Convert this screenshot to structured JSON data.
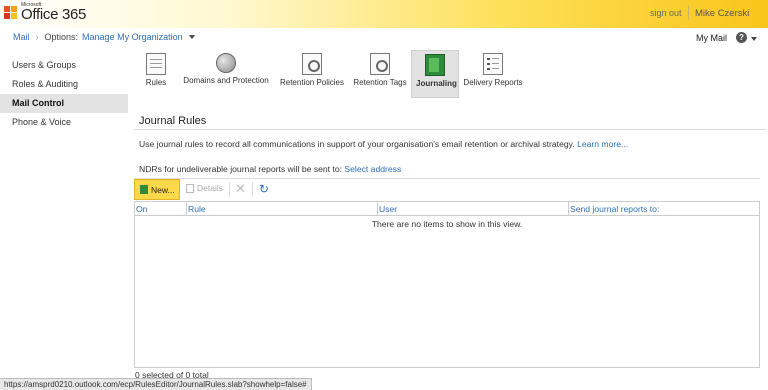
{
  "header": {
    "brand_small": "Microsoft",
    "brand_product": "Office 365",
    "signout_label": "sign out",
    "user_name": "Mike Czerski",
    "my_mail_label": "My Mail",
    "help_glyph": "?"
  },
  "breadcrumb": {
    "mail_label": "Mail",
    "options_label": "Options:",
    "scope_label": "Manage My Organization"
  },
  "leftnav": {
    "items": [
      {
        "label": "Users & Groups",
        "active": false
      },
      {
        "label": "Roles & Auditing",
        "active": false
      },
      {
        "label": "Mail Control",
        "active": true
      },
      {
        "label": "Phone & Voice",
        "active": false
      }
    ]
  },
  "tabs": [
    {
      "label": "Rules",
      "icon": "rules-icon",
      "active": false
    },
    {
      "label": "Domains and Protection",
      "icon": "globe-icon",
      "active": false
    },
    {
      "label": "Retention Policies",
      "icon": "retention-policies-icon",
      "active": false
    },
    {
      "label": "Retention Tags",
      "icon": "retention-tags-icon",
      "active": false
    },
    {
      "label": "Journaling",
      "icon": "journal-book-icon",
      "active": true
    },
    {
      "label": "Delivery Reports",
      "icon": "delivery-reports-icon",
      "active": false
    }
  ],
  "main": {
    "title": "Journal Rules",
    "description": "Use journal rules to record all communications in support of your organisation's email retention or archival strategy.",
    "learn_more": "Learn more...",
    "ndr_text": "NDRs for undeliverable journal reports will be sent to:",
    "ndr_link": "Select address"
  },
  "toolbar": {
    "new_label": "New...",
    "details_label": "Details",
    "delete_glyph": "✕",
    "refresh_glyph": "↻"
  },
  "table": {
    "columns": [
      "On",
      "Rule",
      "User",
      "Send journal reports to:"
    ],
    "empty_message": "There are no items to show in this view.",
    "count_text": "0 selected of 0 total"
  },
  "statusbar": {
    "url": "https://amsprd0210.outlook.com/ecp/RulesEditor/JournalRules.slab?showhelp=false#"
  },
  "colors": {
    "accent_link": "#2f6fb5",
    "new_button": "#fcd94a",
    "header_gradient_end": "#f9c51a"
  }
}
